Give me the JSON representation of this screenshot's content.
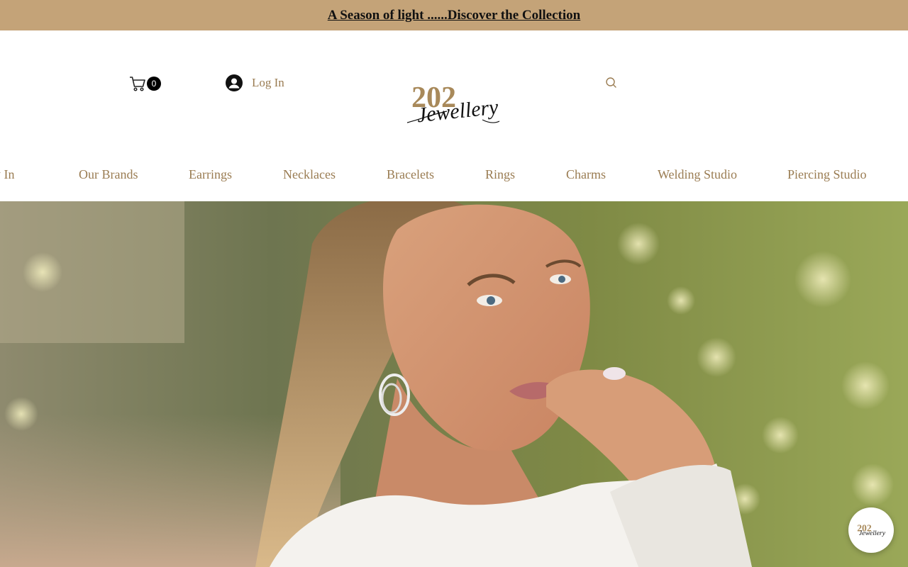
{
  "announcement": {
    "text": "A Season of light ......Discover the Collection"
  },
  "header": {
    "cart_count": "0",
    "login_label": "Log In",
    "logo": {
      "number": "202",
      "word": "Jewellery"
    }
  },
  "nav": {
    "items": [
      {
        "label": "New In"
      },
      {
        "label": "Our Brands"
      },
      {
        "label": "Earrings"
      },
      {
        "label": "Necklaces"
      },
      {
        "label": "Bracelets"
      },
      {
        "label": "Rings"
      },
      {
        "label": "Charms"
      },
      {
        "label": "Welding Studio"
      },
      {
        "label": "Piercing Studio"
      }
    ]
  },
  "colors": {
    "accent": "#9a7c52",
    "banner": "#c4a378",
    "logo_gold": "#a8895a"
  },
  "icons": [
    "cart-icon",
    "user-icon",
    "search-icon",
    "chat-logo-icon"
  ]
}
